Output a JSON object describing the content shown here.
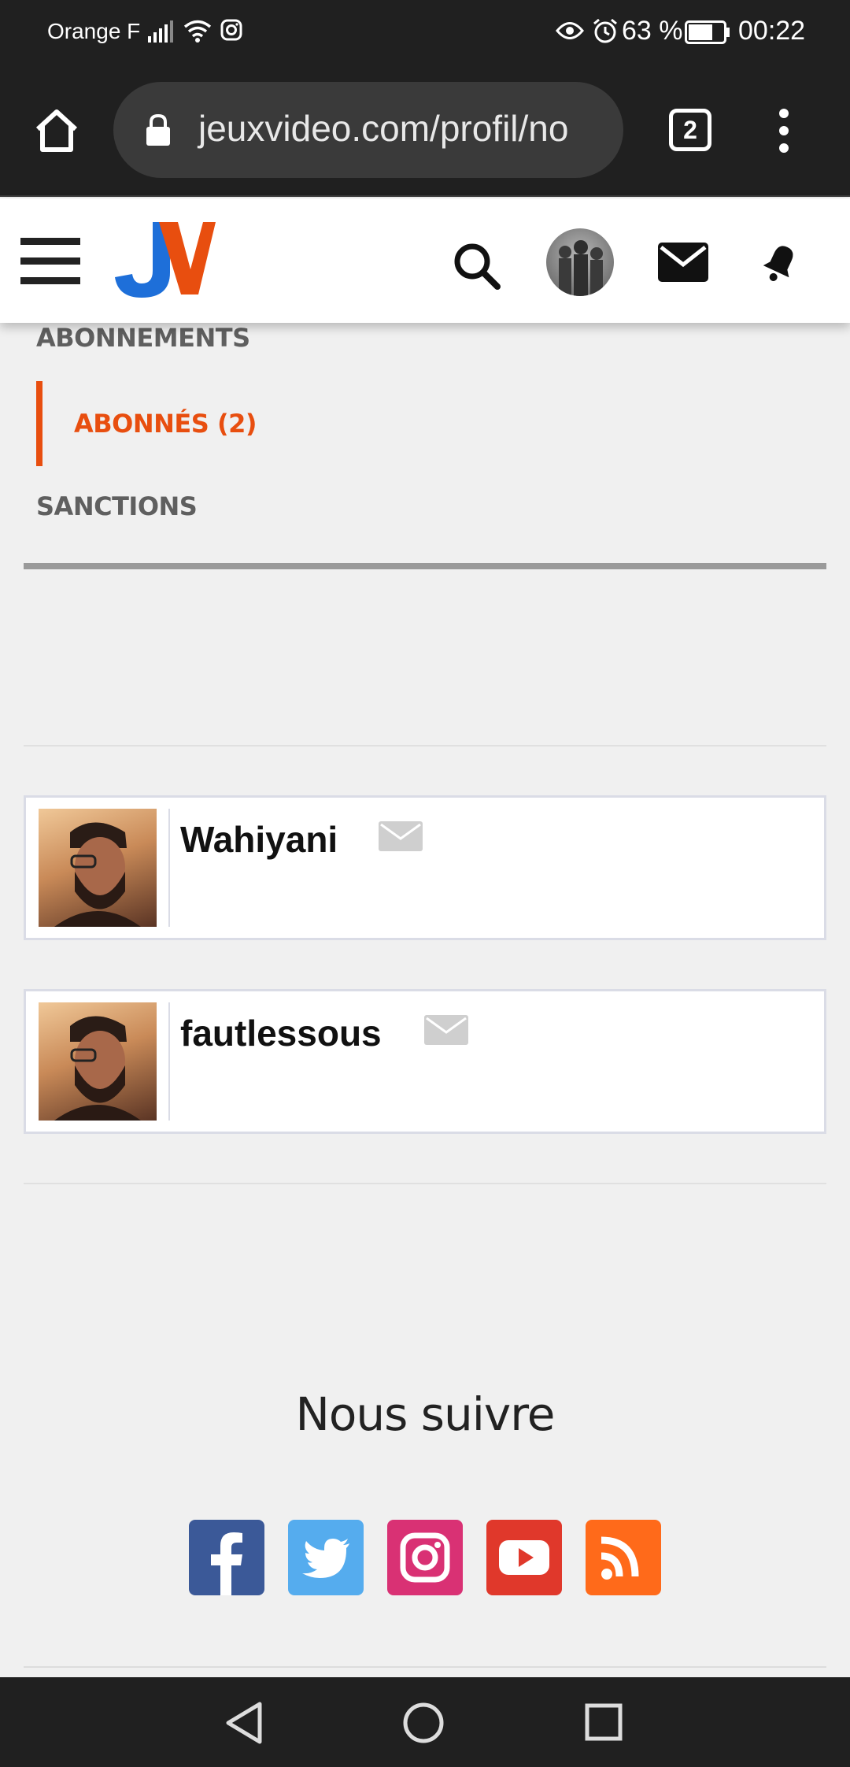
{
  "status_bar": {
    "carrier": "Orange F",
    "battery_percent": "63 %",
    "time": "00:22",
    "icons": [
      "signal-icon",
      "wifi-icon",
      "instagram-notification-icon",
      "eye-icon",
      "alarm-icon",
      "battery-icon"
    ]
  },
  "browser": {
    "url": "jeuxvideo.com/profil/no",
    "tab_count": "2"
  },
  "site": {
    "brand_colors": {
      "orange": "#e84e0f",
      "blue": "#1e6fd9"
    },
    "header_icons": [
      "hamburger-menu-icon",
      "jv-logo",
      "search-icon",
      "user-avatar",
      "mail-icon",
      "notifications-bell-icon"
    ]
  },
  "profile_nav": {
    "items": [
      {
        "label": "ABONNEMENTS",
        "active": false
      },
      {
        "label": "ABONNÉS (2)",
        "active": true
      },
      {
        "label": "SANCTIONS",
        "active": false
      }
    ]
  },
  "followers": [
    {
      "username": "Wahiyani"
    },
    {
      "username": "fautlessous"
    }
  ],
  "footer": {
    "follow_title": "Nous suivre",
    "social": [
      "facebook",
      "twitter",
      "instagram",
      "youtube",
      "rss"
    ]
  }
}
